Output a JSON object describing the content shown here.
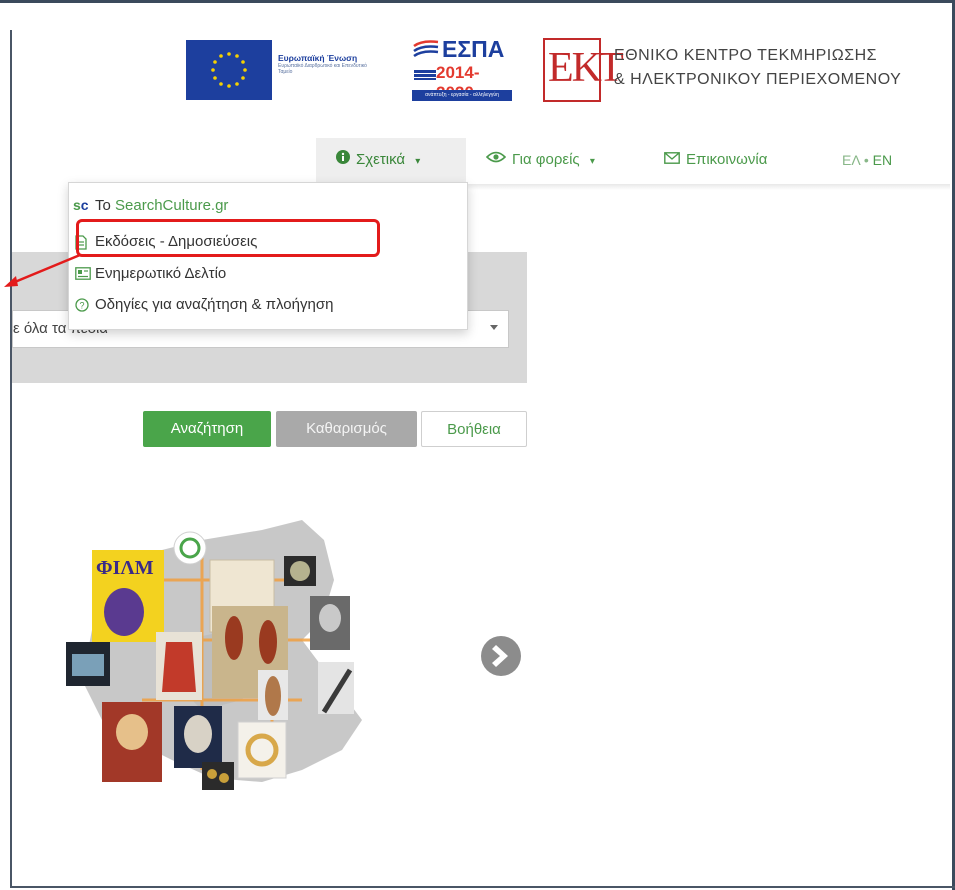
{
  "logos": {
    "eu": {
      "title": "Ευρωπαϊκή Ένωση",
      "subtitle": "Ευρωπαϊκό Διαρθρωτικό και Επενδυτικό Ταμείο"
    },
    "espa": {
      "title": "ΕΣΠΑ",
      "years": "2014-2020",
      "strip": "ανάπτυξη - εργασία - αλληλεγγύη"
    },
    "ekt": {
      "letters": "ΕΚΤ",
      "name_line1": "ΕΘΝΙΚΟ ΚΕΝΤΡΟ ΤΕΚΜΗΡΙΩΣΗΣ",
      "name_line2": "& ΗΛΕΚΤΡΟΝΙΚΟΥ ΠΕΡΙΕΧΟΜΕΝΟΥ"
    }
  },
  "nav": {
    "about": "Σχετικά",
    "partners": "Για φορείς",
    "contact": "Επικοινωνία",
    "lang_el": "ΕΛ",
    "lang_sep": "•",
    "lang_en": "EN"
  },
  "dropdown": {
    "item1_prefix": "Το ",
    "item1_link": "SearchCulture.gr",
    "item2": "Εκδόσεις - Δημοσιεύσεις",
    "item3": "Ενημερωτικό Δελτίο",
    "item4": "Οδηγίες για αναζήτηση & πλοήγηση"
  },
  "search": {
    "select_value": "ε όλα τα πεδία"
  },
  "buttons": {
    "search": "Αναζήτηση",
    "clear": "Καθαρισμός",
    "help": "Βοήθεια"
  },
  "colors": {
    "accent_green": "#4aa54a",
    "highlight_red": "#e31b1b",
    "panel_gray": "#d8d8d8"
  }
}
